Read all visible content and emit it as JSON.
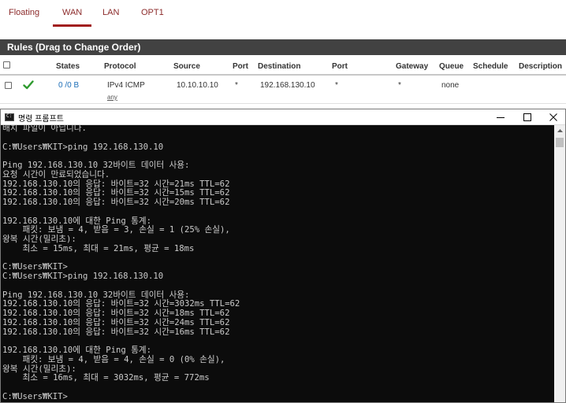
{
  "tabs": [
    {
      "label": "Floating",
      "active": false
    },
    {
      "label": "WAN",
      "active": true
    },
    {
      "label": "LAN",
      "active": false
    },
    {
      "label": "OPT1",
      "active": false
    }
  ],
  "panel": {
    "title": "Rules (Drag to Change Order)"
  },
  "rules_table": {
    "headers": {
      "states": "States",
      "protocol": "Protocol",
      "source": "Source",
      "source_port": "Port",
      "destination": "Destination",
      "dest_port": "Port",
      "gateway": "Gateway",
      "queue": "Queue",
      "schedule": "Schedule",
      "description": "Description"
    },
    "rows": [
      {
        "states": "0 /0 B",
        "protocol": "IPv4 ICMP",
        "protocol_sub": "any",
        "source": "10.10.10.10",
        "source_port": "*",
        "destination": "192.168.130.10",
        "dest_port": "*",
        "gateway": "*",
        "queue": "none",
        "schedule": "",
        "description": ""
      }
    ],
    "colors": {
      "pass_icon": "#2e9a2e",
      "link": "#1e6fb8"
    }
  },
  "cmd_window": {
    "title": "명령 프롬프트",
    "lines": [
      "배치 파일이 아닙니다.",
      "",
      "C:₩Users₩KIT>ping 192.168.130.10",
      "",
      "Ping 192.168.130.10 32바이트 데이터 사용:",
      "요청 시간이 만료되었습니다.",
      "192.168.130.10의 응답: 바이트=32 시간=21ms TTL=62",
      "192.168.130.10의 응답: 바이트=32 시간=15ms TTL=62",
      "192.168.130.10의 응답: 바이트=32 시간=20ms TTL=62",
      "",
      "192.168.130.10에 대한 Ping 통계:",
      "    패킷: 보냄 = 4, 받음 = 3, 손실 = 1 (25% 손실),",
      "왕복 시간(밀리초):",
      "    최소 = 15ms, 최대 = 21ms, 평균 = 18ms",
      "",
      "C:₩Users₩KIT>",
      "C:₩Users₩KIT>ping 192.168.130.10",
      "",
      "Ping 192.168.130.10 32바이트 데이터 사용:",
      "192.168.130.10의 응답: 바이트=32 시간=3032ms TTL=62",
      "192.168.130.10의 응답: 바이트=32 시간=18ms TTL=62",
      "192.168.130.10의 응답: 바이트=32 시간=24ms TTL=62",
      "192.168.130.10의 응답: 바이트=32 시간=16ms TTL=62",
      "",
      "192.168.130.10에 대한 Ping 통계:",
      "    패킷: 보냄 = 4, 받음 = 4, 손실 = 0 (0% 손실),",
      "왕복 시간(밀리초):",
      "    최소 = 16ms, 최대 = 3032ms, 평균 = 772ms",
      "",
      "C:₩Users₩KIT>"
    ],
    "colors": {
      "background": "#0c0c0c",
      "text": "#cccccc"
    }
  }
}
